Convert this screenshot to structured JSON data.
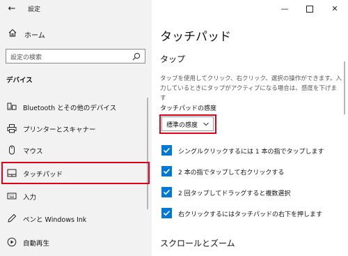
{
  "window": {
    "title": "設定",
    "back_icon": "back-arrow-icon",
    "controls": [
      "minimize-icon",
      "maximize-icon",
      "close-icon"
    ]
  },
  "sidebar": {
    "home_label": "ホーム",
    "search_placeholder": "設定の検索",
    "section_header": "デバイス",
    "items": [
      {
        "label": "Bluetooth とその他のデバイス",
        "icon": "bluetooth-devices-icon"
      },
      {
        "label": "プリンターとスキャナー",
        "icon": "printer-icon"
      },
      {
        "label": "マウス",
        "icon": "mouse-icon"
      },
      {
        "label": "タッチパッド",
        "icon": "touchpad-icon",
        "selected": true
      },
      {
        "label": "入力",
        "icon": "keyboard-icon"
      },
      {
        "label": "ペンと Windows Ink",
        "icon": "pen-icon"
      },
      {
        "label": "自動再生",
        "icon": "autoplay-icon"
      }
    ]
  },
  "main": {
    "page_title": "タッチパッド",
    "subheader": "タップ",
    "description": "タップを使用してクリック、右クリック、選択の操作ができます。入力しているときにタップがアクティブになる場合は、感度を下げます",
    "sensitivity_label": "タッチパッドの感度",
    "sensitivity_value": "標準の感度",
    "checkboxes": [
      {
        "label": "シングルクリックするには 1 本の指でタップします",
        "checked": true
      },
      {
        "label": "2 本の指でタップして右クリックする",
        "checked": true
      },
      {
        "label": "2 回タップしてドラッグすると複数選択",
        "checked": true
      },
      {
        "label": "右クリックするにはタッチパッドの右下を押します",
        "checked": true
      }
    ],
    "next_section": "スクロールとズーム"
  },
  "colors": {
    "accent": "#0078d7",
    "highlight": "#e1001a",
    "sidebar_bg": "#f2f2f2"
  }
}
